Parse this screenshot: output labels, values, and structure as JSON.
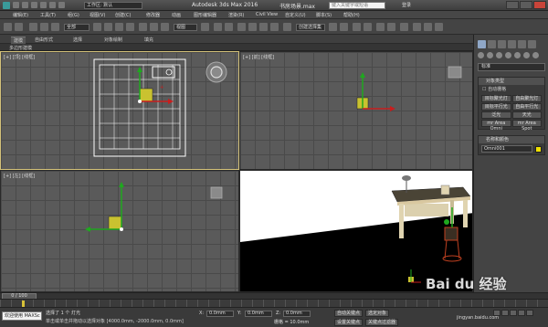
{
  "titlebar": {
    "workspace": "工作区: 默认",
    "app_title": "Autodesk 3ds Max 2016",
    "file_title": "书房场景.max",
    "search_placeholder": "键入关键字或短语",
    "sign_in": "登录"
  },
  "menu": [
    "编辑(E)",
    "工具(T)",
    "组(G)",
    "视图(V)",
    "创建(C)",
    "修改器",
    "动画",
    "图形编辑器",
    "渲染(R)",
    "Civil View",
    "自定义(U)",
    "脚本(S)",
    "帮助(H)"
  ],
  "toolbar": {
    "selection_filter": "全部",
    "ref_coord": "视图",
    "named_selection": "创建选择集"
  },
  "ribbon": {
    "tabs": [
      "建模",
      "自由形式",
      "选择",
      "对象绘制",
      "填充"
    ],
    "active_tab": "建模",
    "sub_label": "多边形建模"
  },
  "viewports": {
    "top_left": "[+] [顶] [线框]",
    "top_right": "[+] [前] [线框]",
    "bottom_left": "[+] [左] [线框]"
  },
  "command_panel": {
    "dropdown": "标准",
    "object_type_header": "对象类型",
    "auto_grid": "自动栅格",
    "buttons": [
      "目标聚光灯",
      "自由聚光灯",
      "目标平行光",
      "自由平行光",
      "泛光",
      "天光",
      "mr Area Omni",
      "mr Area Spot"
    ],
    "name_color_header": "名称和颜色",
    "object_name": "Omni001"
  },
  "timeline": {
    "frame": "0 / 100",
    "ticks": [
      "0",
      "5",
      "10",
      "15",
      "20",
      "25",
      "30",
      "35",
      "40",
      "45",
      "50",
      "55",
      "60",
      "65",
      "70",
      "75",
      "80",
      "85",
      "90",
      "95",
      "100"
    ]
  },
  "statusbar": {
    "maxscript": "欢迎使用 MAXSc",
    "status_line1": "选择了 1 个 灯光",
    "status_line2": "单击或单击并拖动以选择对象 [4000.0mm, -2000.0mm, 0.0mm]",
    "x_label": "X:",
    "x_value": "0.0mm",
    "y_label": "Y:",
    "y_value": "0.0mm",
    "z_label": "Z:",
    "z_value": "0.0mm",
    "grid": "栅格 = 10.0mm",
    "auto_key": "自动关键点",
    "selected": "选定对象",
    "set_key": "设置关键点",
    "key_filter": "关键点过滤器"
  },
  "watermark": {
    "main": "Bai du 经验",
    "sub": "jingyan.baidu.com"
  },
  "colors": {
    "accent_active_border": "#d4c27a",
    "light_color": "#f0e000",
    "close_button": "#c8443a"
  }
}
